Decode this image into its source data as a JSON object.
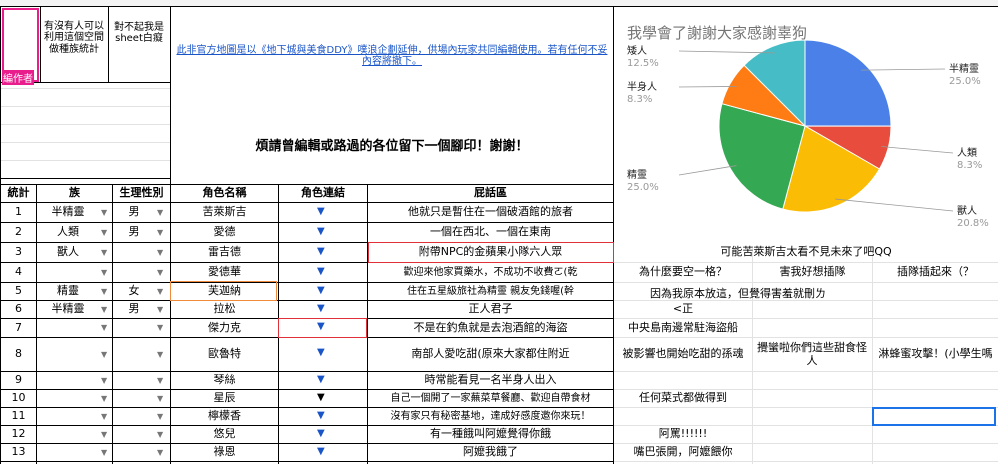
{
  "top_notes": {
    "label1": "有沒有人可以利用這個空間做種族統計",
    "label2": "對不起我是sheet白癡",
    "editor_label": "編作者",
    "notice_link": "此非官方地圖是以《地下城與美食DDY》噗浪企劃延伸，供場內玩家共同編輯使用。若有任何不妥內容將撤下。",
    "banner": "煩請曾編輯或路過的各位留下一個腳印！謝謝！"
  },
  "table": {
    "headers": [
      "統計",
      "族",
      "生理性別",
      "角色名稱",
      "角色連結",
      "屁話區"
    ],
    "rows": [
      {
        "n": "1",
        "race": "半精靈",
        "sex": "男",
        "name": "苦萊斯吉",
        "link": "▼",
        "talk": "他就只是暫住在一個破酒館的旅者"
      },
      {
        "n": "2",
        "race": "人類",
        "sex": "男",
        "name": "愛德",
        "link": "▼",
        "talk": "一個在西北、一個在東南"
      },
      {
        "n": "3",
        "race": "獸人",
        "sex": "",
        "name": "雷吉德",
        "link": "▼",
        "talk": "附帶NPC的金蘋果小隊六人眾"
      },
      {
        "n": "4",
        "race": "",
        "sex": "",
        "name": "愛德華",
        "link": "▼",
        "talk": "歡迎來他家買藥水，不成功不收費ㄛ(乾"
      },
      {
        "n": "5",
        "race": "精靈",
        "sex": "女",
        "name": "芙迦納",
        "link": "▼",
        "talk": "住在五星級旅社為精靈 親友免錢喔(幹"
      },
      {
        "n": "6",
        "race": "半精靈",
        "sex": "男",
        "name": "拉松",
        "link": "▼",
        "talk": "正人君子"
      },
      {
        "n": "7",
        "race": "",
        "sex": "",
        "name": "傑力克",
        "link": "▼",
        "talk": "不是在釣魚就是去泡酒館的海盜"
      },
      {
        "n": "8",
        "race": "",
        "sex": "",
        "name": "歐魯特",
        "link": "▼",
        "talk": "南部人愛吃甜(原來大家都住附近"
      },
      {
        "n": "9",
        "race": "",
        "sex": "",
        "name": "琴絲",
        "link": "▼",
        "talk": "時常能看見一名半身人出入"
      },
      {
        "n": "10",
        "race": "",
        "sex": "",
        "name": "星辰",
        "link": "▼",
        "talk": "自己一個開了一家蕪菜草餐廳、歡迎自帶食材"
      },
      {
        "n": "11",
        "race": "",
        "sex": "",
        "name": "檸檬香",
        "link": "▼",
        "talk": "沒有家只有秘密基地，達成好感度邀你來玩！"
      },
      {
        "n": "12",
        "race": "",
        "sex": "",
        "name": "悠兒",
        "link": "▼",
        "talk": "有一種餓叫阿嬤覺得你餓"
      },
      {
        "n": "13",
        "race": "",
        "sex": "",
        "name": "祿恩",
        "link": "▼",
        "talk": "阿嬤我餓了"
      }
    ]
  },
  "side_comments": {
    "r3": "可能苦萊斯吉太看不見未來了吧QQ",
    "r4a": "為什麼要空一格？",
    "r4b": "害我好想插隊",
    "r4c": "插隊插起來（？",
    "r5": "因為我原本放這，但覺得害羞就刪ㄌ",
    "r6": "<正",
    "r7": "中央島南邊常駐海盜船",
    "r8a": "被影響也開始吃甜的孫魂",
    "r8b": "攪蠻啦你們這些甜食怪人",
    "r8c": "淋蜂蜜攻擊！(小學生嗎",
    "r10": "任何菜式都做得到",
    "r12": "阿罵!!!!!!",
    "r13": "嘴巴張開，阿嬤餵你"
  },
  "colors": {
    "accent_red": "#e0303a",
    "accent_orange": "#f08a3c",
    "link_blue": "#1a55c8",
    "select_blue": "#1a73e8",
    "pink": "#e91e8c"
  },
  "chart_data": {
    "type": "pie",
    "title": "我學會了謝謝大家感謝辜狗",
    "slices": [
      {
        "label": "半精靈",
        "value": 25.0,
        "pct": "25.0%",
        "color": "#4a80e8"
      },
      {
        "label": "人類",
        "value": 8.3,
        "pct": "8.3%",
        "color": "#e84c3d"
      },
      {
        "label": "獸人",
        "value": 20.8,
        "pct": "20.8%",
        "color": "#fbbc05"
      },
      {
        "label": "精靈",
        "value": 25.0,
        "pct": "25.0%",
        "color": "#34a853"
      },
      {
        "label": "半身人",
        "value": 8.3,
        "pct": "8.3%",
        "color": "#ff7c14"
      },
      {
        "label": "矮人",
        "value": 12.5,
        "pct": "12.5%",
        "color": "#46bdc6"
      }
    ]
  }
}
